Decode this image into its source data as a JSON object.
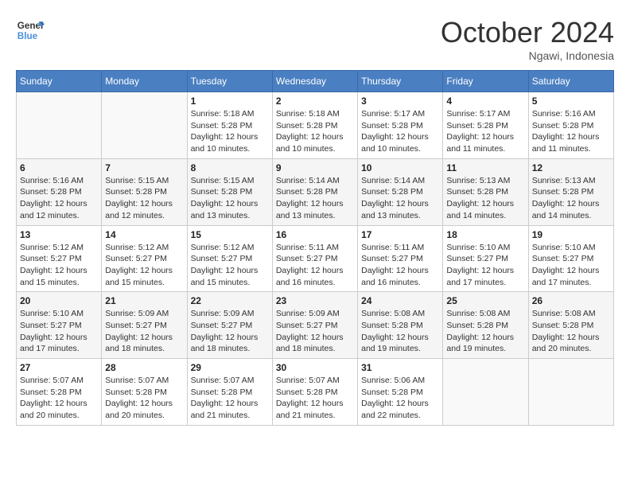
{
  "header": {
    "logo_general": "General",
    "logo_blue": "Blue",
    "month_title": "October 2024",
    "location": "Ngawi, Indonesia"
  },
  "weekdays": [
    "Sunday",
    "Monday",
    "Tuesday",
    "Wednesday",
    "Thursday",
    "Friday",
    "Saturday"
  ],
  "weeks": [
    [
      {
        "day": "",
        "info": ""
      },
      {
        "day": "",
        "info": ""
      },
      {
        "day": "1",
        "info": "Sunrise: 5:18 AM\nSunset: 5:28 PM\nDaylight: 12 hours and 10 minutes."
      },
      {
        "day": "2",
        "info": "Sunrise: 5:18 AM\nSunset: 5:28 PM\nDaylight: 12 hours and 10 minutes."
      },
      {
        "day": "3",
        "info": "Sunrise: 5:17 AM\nSunset: 5:28 PM\nDaylight: 12 hours and 10 minutes."
      },
      {
        "day": "4",
        "info": "Sunrise: 5:17 AM\nSunset: 5:28 PM\nDaylight: 12 hours and 11 minutes."
      },
      {
        "day": "5",
        "info": "Sunrise: 5:16 AM\nSunset: 5:28 PM\nDaylight: 12 hours and 11 minutes."
      }
    ],
    [
      {
        "day": "6",
        "info": "Sunrise: 5:16 AM\nSunset: 5:28 PM\nDaylight: 12 hours and 12 minutes."
      },
      {
        "day": "7",
        "info": "Sunrise: 5:15 AM\nSunset: 5:28 PM\nDaylight: 12 hours and 12 minutes."
      },
      {
        "day": "8",
        "info": "Sunrise: 5:15 AM\nSunset: 5:28 PM\nDaylight: 12 hours and 13 minutes."
      },
      {
        "day": "9",
        "info": "Sunrise: 5:14 AM\nSunset: 5:28 PM\nDaylight: 12 hours and 13 minutes."
      },
      {
        "day": "10",
        "info": "Sunrise: 5:14 AM\nSunset: 5:28 PM\nDaylight: 12 hours and 13 minutes."
      },
      {
        "day": "11",
        "info": "Sunrise: 5:13 AM\nSunset: 5:28 PM\nDaylight: 12 hours and 14 minutes."
      },
      {
        "day": "12",
        "info": "Sunrise: 5:13 AM\nSunset: 5:28 PM\nDaylight: 12 hours and 14 minutes."
      }
    ],
    [
      {
        "day": "13",
        "info": "Sunrise: 5:12 AM\nSunset: 5:27 PM\nDaylight: 12 hours and 15 minutes."
      },
      {
        "day": "14",
        "info": "Sunrise: 5:12 AM\nSunset: 5:27 PM\nDaylight: 12 hours and 15 minutes."
      },
      {
        "day": "15",
        "info": "Sunrise: 5:12 AM\nSunset: 5:27 PM\nDaylight: 12 hours and 15 minutes."
      },
      {
        "day": "16",
        "info": "Sunrise: 5:11 AM\nSunset: 5:27 PM\nDaylight: 12 hours and 16 minutes."
      },
      {
        "day": "17",
        "info": "Sunrise: 5:11 AM\nSunset: 5:27 PM\nDaylight: 12 hours and 16 minutes."
      },
      {
        "day": "18",
        "info": "Sunrise: 5:10 AM\nSunset: 5:27 PM\nDaylight: 12 hours and 17 minutes."
      },
      {
        "day": "19",
        "info": "Sunrise: 5:10 AM\nSunset: 5:27 PM\nDaylight: 12 hours and 17 minutes."
      }
    ],
    [
      {
        "day": "20",
        "info": "Sunrise: 5:10 AM\nSunset: 5:27 PM\nDaylight: 12 hours and 17 minutes."
      },
      {
        "day": "21",
        "info": "Sunrise: 5:09 AM\nSunset: 5:27 PM\nDaylight: 12 hours and 18 minutes."
      },
      {
        "day": "22",
        "info": "Sunrise: 5:09 AM\nSunset: 5:27 PM\nDaylight: 12 hours and 18 minutes."
      },
      {
        "day": "23",
        "info": "Sunrise: 5:09 AM\nSunset: 5:27 PM\nDaylight: 12 hours and 18 minutes."
      },
      {
        "day": "24",
        "info": "Sunrise: 5:08 AM\nSunset: 5:28 PM\nDaylight: 12 hours and 19 minutes."
      },
      {
        "day": "25",
        "info": "Sunrise: 5:08 AM\nSunset: 5:28 PM\nDaylight: 12 hours and 19 minutes."
      },
      {
        "day": "26",
        "info": "Sunrise: 5:08 AM\nSunset: 5:28 PM\nDaylight: 12 hours and 20 minutes."
      }
    ],
    [
      {
        "day": "27",
        "info": "Sunrise: 5:07 AM\nSunset: 5:28 PM\nDaylight: 12 hours and 20 minutes."
      },
      {
        "day": "28",
        "info": "Sunrise: 5:07 AM\nSunset: 5:28 PM\nDaylight: 12 hours and 20 minutes."
      },
      {
        "day": "29",
        "info": "Sunrise: 5:07 AM\nSunset: 5:28 PM\nDaylight: 12 hours and 21 minutes."
      },
      {
        "day": "30",
        "info": "Sunrise: 5:07 AM\nSunset: 5:28 PM\nDaylight: 12 hours and 21 minutes."
      },
      {
        "day": "31",
        "info": "Sunrise: 5:06 AM\nSunset: 5:28 PM\nDaylight: 12 hours and 22 minutes."
      },
      {
        "day": "",
        "info": ""
      },
      {
        "day": "",
        "info": ""
      }
    ]
  ]
}
